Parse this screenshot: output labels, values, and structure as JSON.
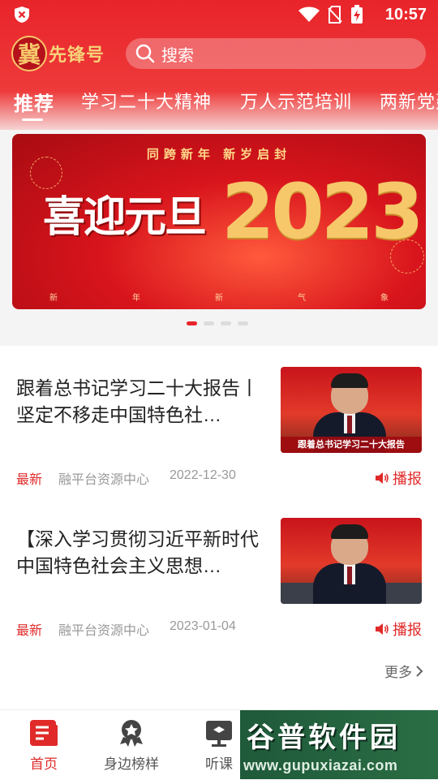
{
  "status_bar": {
    "time": "10:57"
  },
  "header": {
    "logo_char": "冀",
    "logo_text": "先锋号",
    "search_placeholder": "搜索"
  },
  "tabs": [
    {
      "label": "推荐",
      "active": true
    },
    {
      "label": "学习二十大精神",
      "active": false
    },
    {
      "label": "万人示范培训",
      "active": false
    },
    {
      "label": "两新党建",
      "active": false
    }
  ],
  "banner": {
    "subtitle": "同跨新年    新岁启封",
    "headline": "喜迎元旦",
    "year": "2023",
    "strip": [
      "新",
      "年",
      "新",
      "气",
      "象"
    ],
    "dot_count": 4,
    "active_dot": 0
  },
  "articles": [
    {
      "title": "跟着总书记学习二十大报告丨坚定不移走中国特色社…",
      "tag": "最新",
      "source": "融平台资源中心",
      "date": "2022-12-30",
      "action": "播报",
      "thumb_caption": "跟着总书记学习二十大报告"
    },
    {
      "title": "【深入学习贯彻习近平新时代中国特色社会主义思想…",
      "tag": "最新",
      "source": "融平台资源中心",
      "date": "2023-01-04",
      "action": "播报",
      "thumb_caption": ""
    }
  ],
  "more_label": "更多",
  "bottom_nav": [
    {
      "label": "首页",
      "icon": "home-doc-icon",
      "active": true
    },
    {
      "label": "身边榜样",
      "icon": "badge-star-icon",
      "active": false
    },
    {
      "label": "听课",
      "icon": "lecture-icon",
      "active": false
    }
  ],
  "watermark": {
    "title": "谷普软件园",
    "url": "www.gupuxiazai.com"
  },
  "colors": {
    "primary_red": "#e8242a",
    "gold": "#f6c86a"
  }
}
